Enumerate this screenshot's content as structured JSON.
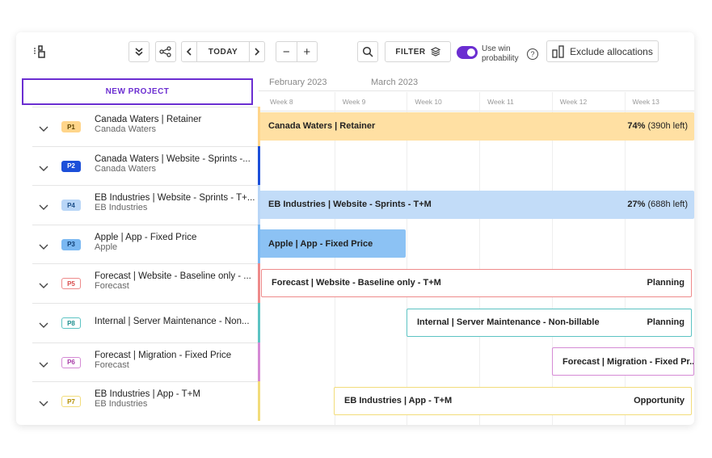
{
  "toolbar": {
    "today_label": "TODAY",
    "filter_label": "FILTER",
    "win_prob_label_line1": "Use win",
    "win_prob_label_line2": "probability",
    "win_prob_on": true,
    "exclude_label": "Exclude allocations",
    "help_symbol": "?",
    "minus_symbol": "−",
    "plus_symbol": "+"
  },
  "sidebar": {
    "new_project_label": "NEW PROJECT",
    "projects": [
      {
        "badge": "P1",
        "title": "Canada Waters | Retainer",
        "subtitle": "Canada Waters",
        "badge_bg": "#ffd58a",
        "badge_fg": "#5a4000",
        "badge_border": "#ffd58a",
        "stripe": "#ffd58a"
      },
      {
        "badge": "P2",
        "title": "Canada Waters | Website - Sprints -...",
        "subtitle": "Canada Waters",
        "badge_bg": "#1c4fd9",
        "badge_fg": "#ffffff",
        "badge_border": "#1c4fd9",
        "stripe": "#1c4fd9"
      },
      {
        "badge": "P4",
        "title": "EB Industries | Website - Sprints - T+...",
        "subtitle": "EB Industries",
        "badge_bg": "#b9d6f7",
        "badge_fg": "#1d4f8a",
        "badge_border": "#b9d6f7",
        "stripe": "#b9d6f7"
      },
      {
        "badge": "P3",
        "title": "Apple | App - Fixed Price",
        "subtitle": "Apple",
        "badge_bg": "#7ab8f2",
        "badge_fg": "#0f3e73",
        "badge_border": "#7ab8f2",
        "stripe": "#7ab8f2"
      },
      {
        "badge": "P5",
        "title": "Forecast | Website - Baseline only - ...",
        "subtitle": "Forecast",
        "badge_bg": "#ffffff",
        "badge_fg": "#d84d4d",
        "badge_border": "#ee8a8a",
        "stripe": "#ee8a8a"
      },
      {
        "badge": "P8",
        "title": "Internal | Server Maintenance - Non...",
        "subtitle": "",
        "badge_bg": "#ffffff",
        "badge_fg": "#1e8f8f",
        "badge_border": "#5cc3c3",
        "stripe": "#5cc3c3"
      },
      {
        "badge": "P6",
        "title": "Forecast | Migration - Fixed Price",
        "subtitle": "Forecast",
        "badge_bg": "#ffffff",
        "badge_fg": "#a63aa6",
        "badge_border": "#d58ad5",
        "stripe": "#d58ad5"
      },
      {
        "badge": "P7",
        "title": "EB Industries | App - T+M",
        "subtitle": "EB Industries",
        "badge_bg": "#ffffff",
        "badge_fg": "#b38f00",
        "badge_border": "#f2dc7a",
        "stripe": "#f2dc7a"
      }
    ]
  },
  "timeline": {
    "months": [
      {
        "label": "February 2023"
      },
      {
        "label": "March 2023"
      }
    ],
    "weeks": [
      "Week 8",
      "Week 9",
      "Week 10",
      "Week 11",
      "Week 12",
      "Week 13"
    ],
    "bars": [
      {
        "row": 0,
        "label": "Canada Waters | Retainer",
        "pct": "74%",
        "rest": " (390h left)",
        "status": "",
        "bg": "#ffe0a3",
        "border": "#ffe0a3"
      },
      {
        "row": 2,
        "label": "EB Industries | Website - Sprints - T+M",
        "pct": "27%",
        "rest": " (688h left)",
        "status": "",
        "bg": "#c2dcf8",
        "border": "#c2dcf8"
      },
      {
        "row": 3,
        "label": "Apple | App - Fixed Price",
        "pct": "",
        "rest": "",
        "status": "",
        "bg": "#8cc2f4",
        "border": "#8cc2f4"
      },
      {
        "row": 4,
        "label": "Forecast | Website - Baseline only - T+M",
        "pct": "",
        "rest": "",
        "status": "Planning",
        "bg": "#ffffff",
        "border": "#ee8a8a"
      },
      {
        "row": 5,
        "label": "Internal | Server Maintenance - Non-billable",
        "pct": "",
        "rest": "",
        "status": "Planning",
        "bg": "#ffffff",
        "border": "#5cc3c3"
      },
      {
        "row": 6,
        "label": "Forecast | Migration - Fixed Pr...",
        "pct": "",
        "rest": "",
        "status": "",
        "bg": "#ffffff",
        "border": "#d58ad5"
      },
      {
        "row": 7,
        "label": "EB Industries | App - T+M",
        "pct": "",
        "rest": "",
        "status": "Opportunity",
        "bg": "#ffffff",
        "border": "#f2dc7a"
      }
    ]
  },
  "colors": {
    "accent": "#6b2ed1"
  },
  "icons": [
    "split-view-icon",
    "collapse-all-icon",
    "share-nodes-icon",
    "chevron-left-icon",
    "chevron-right-icon",
    "search-icon",
    "filter-layers-icon",
    "help-icon",
    "columns-icon",
    "chevron-down-icon"
  ]
}
